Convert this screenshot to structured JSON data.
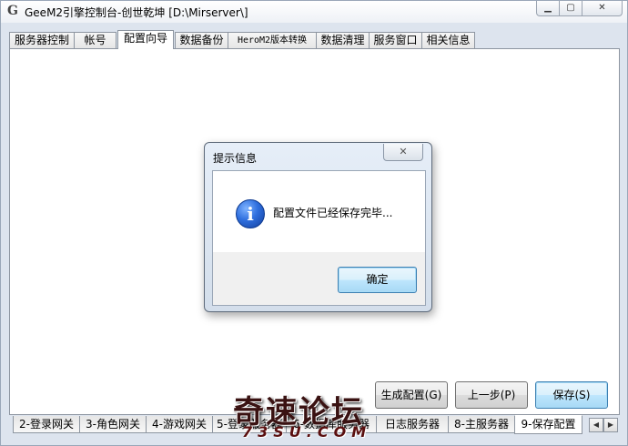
{
  "window": {
    "title": "GeeM2引擎控制台-创世乾坤 [D:\\Mirserver\\]",
    "app_icon_glyph": "G",
    "minimize_glyph": "▁",
    "maximize_glyph": "▢",
    "close_glyph": "✕"
  },
  "top_tabs": [
    {
      "label": "服务器控制"
    },
    {
      "label": "帐号"
    },
    {
      "label": "配置向导",
      "active": true
    },
    {
      "label": "数据备份"
    },
    {
      "label": "HeroM2版本转换"
    },
    {
      "label": "数据清理"
    },
    {
      "label": "服务窗口"
    },
    {
      "label": "相关信息"
    }
  ],
  "buttons": {
    "generate": "生成配置(G)",
    "previous": "上一步(P)",
    "save": "保存(S)"
  },
  "bottom_tabs": [
    {
      "label": "2-登录网关"
    },
    {
      "label": "3-角色网关"
    },
    {
      "label": "4-游戏网关"
    },
    {
      "label": "5-登录服务器"
    },
    {
      "label": "6-数据库服务器"
    },
    {
      "label": "日志服务器"
    },
    {
      "label": "8-主服务器"
    },
    {
      "label": "9-保存配置",
      "active": true
    }
  ],
  "scroll": {
    "left_glyph": "◀",
    "right_glyph": "▶"
  },
  "dialog": {
    "title": "提示信息",
    "close_glyph": "✕",
    "icon_glyph": "i",
    "message": "配置文件已经保存完毕...",
    "ok_label": "确定"
  },
  "watermark": {
    "main": "奇速论坛",
    "sub": "73SU.COM"
  },
  "colors": {
    "window_bg": "#dde4ee",
    "panel_bg": "#ffffff",
    "default_button": "#a7d9f5",
    "info_icon": "#2f6fde"
  }
}
